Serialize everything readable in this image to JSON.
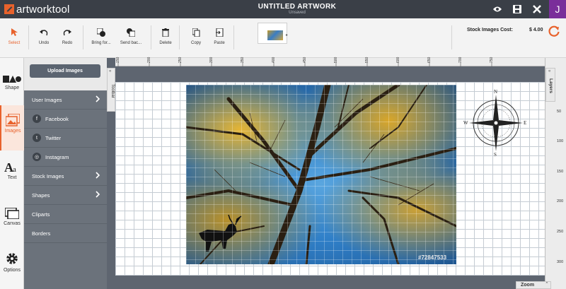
{
  "app": {
    "logo_text": "artworktool",
    "title": "UNTITLED ARTWORK",
    "subtitle": "Unsaved",
    "avatar_initial": "J"
  },
  "toolbar": {
    "select": "Select",
    "undo": "Undo",
    "redo": "Redo",
    "bring_forward": "Bring for...",
    "send_back": "Send bac...",
    "delete": "Delete",
    "copy": "Copy",
    "paste": "Paste",
    "cost_label": "Stock Images Cost:",
    "cost_value": "$ 4.00"
  },
  "rail": {
    "shape": "Shape",
    "images": "Images",
    "text": "Text",
    "canvas": "Canvas",
    "options": "Options"
  },
  "panel": {
    "upload": "Upload Images",
    "user_images": "User Images",
    "facebook": "Facebook",
    "twitter": "Twitter",
    "instagram": "Instagram",
    "stock_images": "Stock Images",
    "shapes": "Shapes",
    "cliparts": "Cliparts",
    "borders": "Borders",
    "toolbar_toggle": "Toolbar"
  },
  "canvas": {
    "ruler_top": [
      "150",
      "200",
      "250",
      "300",
      "350",
      "400",
      "450",
      "500",
      "550",
      "600",
      "650",
      "700",
      "750"
    ],
    "ruler_right": [
      "50",
      "100",
      "150",
      "200",
      "250",
      "300"
    ],
    "watermark": "#72847533",
    "compass": [
      "N",
      "E",
      "S",
      "W"
    ],
    "layers": "Layers",
    "zoom": "Zoom"
  },
  "colors": {
    "accent": "#e8622c",
    "topbar": "#3a3f47",
    "panel": "#6b727b",
    "avatar": "#7a2e9a"
  }
}
